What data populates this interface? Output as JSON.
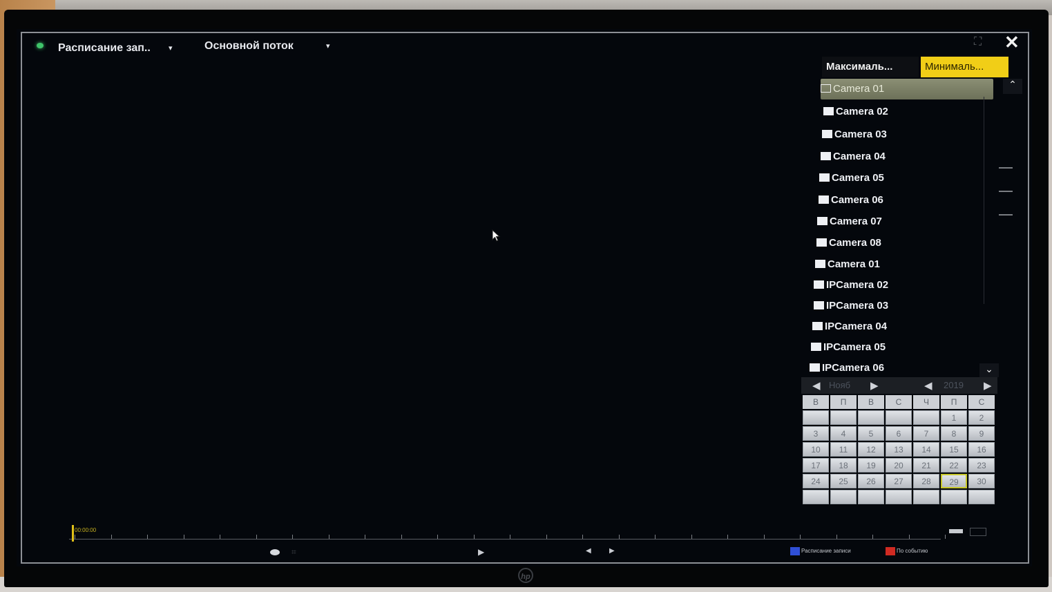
{
  "topbar": {
    "schedule_label": "Расписание зап..",
    "schedule_arrow": "▾",
    "stream_label": "Основной поток",
    "stream_arrow": "▾",
    "fullscreen_glyph": "⛶",
    "close_glyph": "✕"
  },
  "tabs": {
    "max_label": "Максималь...",
    "min_label": "Минималь..."
  },
  "camera_list": [
    {
      "label": "Camera 01",
      "selected": true
    },
    {
      "label": "Camera 02",
      "selected": false
    },
    {
      "label": "Camera 03",
      "selected": false
    },
    {
      "label": "Camera 04",
      "selected": false
    },
    {
      "label": "Camera 05",
      "selected": false
    },
    {
      "label": "Camera 06",
      "selected": false
    },
    {
      "label": "Camera 07",
      "selected": false
    },
    {
      "label": "Camera 08",
      "selected": false
    },
    {
      "label": "Camera 01",
      "selected": false
    },
    {
      "label": "IPCamera 02",
      "selected": false
    },
    {
      "label": "IPCamera 03",
      "selected": false
    },
    {
      "label": "IPCamera 04",
      "selected": false
    },
    {
      "label": "IPCamera 05",
      "selected": false
    },
    {
      "label": "IPCamera 06",
      "selected": false
    }
  ],
  "scroll": {
    "up_glyph": "⌃",
    "down_glyph": "⌄"
  },
  "calendar": {
    "month": "Нояб",
    "year": "2019",
    "prev_glyph": "◀",
    "next_glyph": "▶",
    "weekdays": [
      "В",
      "П",
      "В",
      "С",
      "Ч",
      "П",
      "С"
    ],
    "weeks": [
      [
        "",
        "",
        "",
        "",
        "",
        "1",
        "2"
      ],
      [
        "3",
        "4",
        "5",
        "6",
        "7",
        "8",
        "9"
      ],
      [
        "10",
        "11",
        "12",
        "13",
        "14",
        "15",
        "16"
      ],
      [
        "17",
        "18",
        "19",
        "20",
        "21",
        "22",
        "23"
      ],
      [
        "24",
        "25",
        "26",
        "27",
        "28",
        "29",
        "30"
      ],
      [
        "",
        "",
        "",
        "",
        "",
        "",
        ""
      ]
    ],
    "highlighted_day": "29"
  },
  "timeline": {
    "time_label": "00:00:00"
  },
  "playback": {
    "play_glyph": "▶",
    "prev_glyph": "◀",
    "next_glyph": "▶"
  },
  "legend": {
    "schedule_label": "Расписание записи",
    "event_label": "По событию",
    "schedule_color": "#2f4fd6",
    "event_color": "#d02a22"
  },
  "monitor": {
    "logo": "hp"
  }
}
